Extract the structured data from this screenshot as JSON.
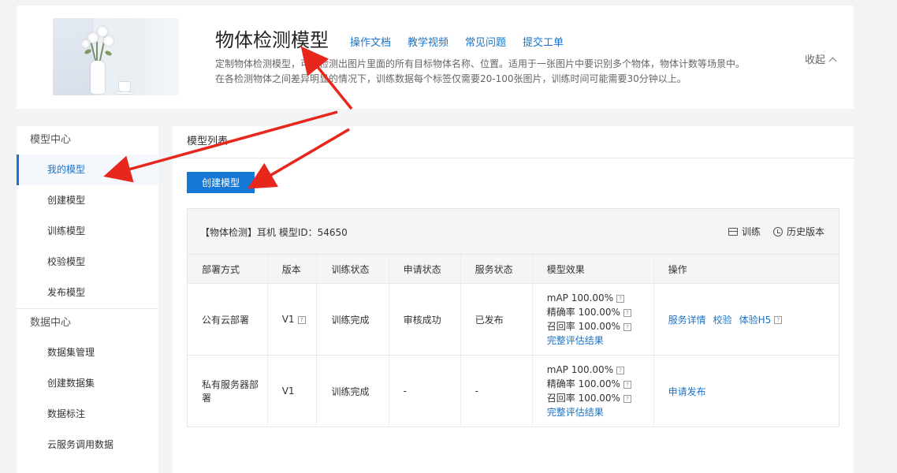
{
  "header": {
    "title": "物体检测模型",
    "links": [
      "操作文档",
      "教学视频",
      "常见问题",
      "提交工单"
    ],
    "desc_line1": "定制物体检测模型，可以检测出图片里面的所有目标物体名称、位置。适用于一张图片中要识别多个物体，物体计数等场景中。",
    "desc_line2": "在各检测物体之间差异明显的情况下，训练数据每个标签仅需要20-100张图片，训练时间可能需要30分钟以上。",
    "collapse": "收起"
  },
  "sidebar": {
    "section1": "模型中心",
    "items1": [
      "我的模型",
      "创建模型",
      "训练模型",
      "校验模型",
      "发布模型"
    ],
    "section2": "数据中心",
    "items2": [
      "数据集管理",
      "创建数据集",
      "数据标注",
      "云服务调用数据"
    ]
  },
  "main": {
    "heading": "模型列表",
    "create_button": "创建模型",
    "model": {
      "name": "【物体检测】耳机 模型ID：54650",
      "action_train": "训练",
      "action_history": "历史版本"
    },
    "table": {
      "headers": [
        "部署方式",
        "版本",
        "训练状态",
        "申请状态",
        "服务状态",
        "模型效果",
        "操作"
      ],
      "rows": [
        {
          "deploy": "公有云部署",
          "version": "V1",
          "train_status": "训练完成",
          "apply_status": "审核成功",
          "service_status": "已发布",
          "map": "mAP 100.00%",
          "precision": "精确率 100.00%",
          "recall": "召回率 100.00%",
          "eval_link": "完整评估结果",
          "ops": [
            "服务详情",
            "校验",
            "体验H5"
          ]
        },
        {
          "deploy": "私有服务器部署",
          "version": "V1",
          "train_status": "训练完成",
          "apply_status": "-",
          "service_status": "-",
          "map": "mAP 100.00%",
          "precision": "精确率 100.00%",
          "recall": "召回率 100.00%",
          "eval_link": "完整评估结果",
          "ops": [
            "申请发布"
          ]
        }
      ]
    }
  },
  "colors": {
    "accent": "#1a73c8",
    "button": "#1479d6",
    "annotation": "#e8271c"
  },
  "icons": [
    "train-icon",
    "history-clock-icon",
    "help-icon",
    "chevron-up-icon"
  ]
}
